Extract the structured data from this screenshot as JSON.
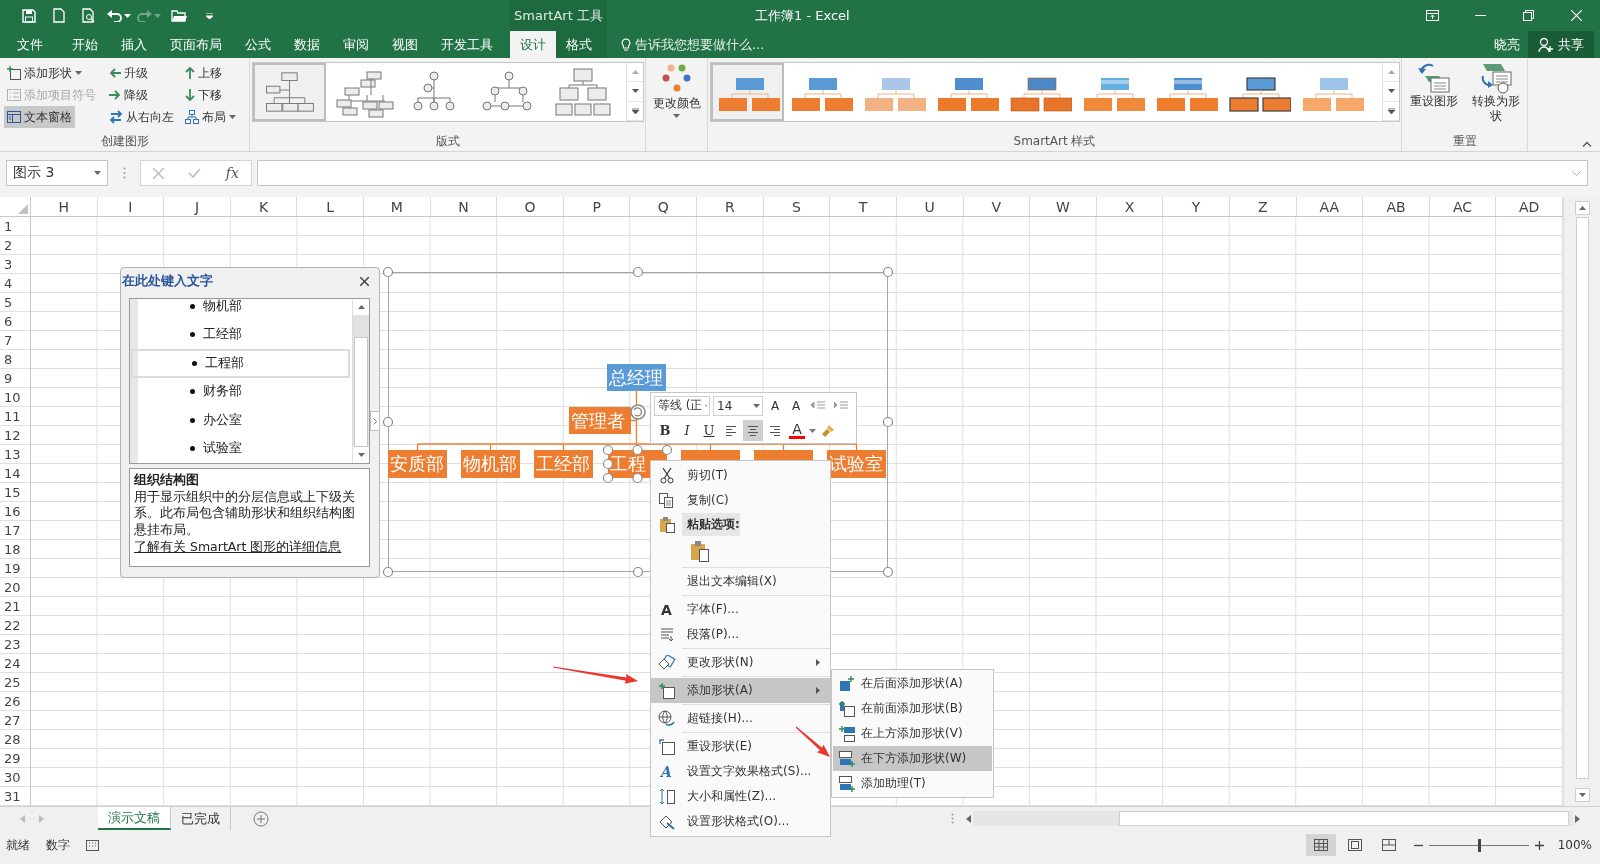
{
  "window": {
    "title": "工作簿1 - Excel",
    "context_group": "SmartArt 工具"
  },
  "ribbon_tabs": [
    {
      "label": "文件",
      "selected": false,
      "contextual": false
    },
    {
      "label": "开始",
      "selected": false,
      "contextual": false
    },
    {
      "label": "插入",
      "selected": false,
      "contextual": false
    },
    {
      "label": "页面布局",
      "selected": false,
      "contextual": false
    },
    {
      "label": "公式",
      "selected": false,
      "contextual": false
    },
    {
      "label": "数据",
      "selected": false,
      "contextual": false
    },
    {
      "label": "审阅",
      "selected": false,
      "contextual": false
    },
    {
      "label": "视图",
      "selected": false,
      "contextual": false
    },
    {
      "label": "开发工具",
      "selected": false,
      "contextual": false
    },
    {
      "label": "设计",
      "selected": true,
      "contextual": true
    },
    {
      "label": "格式",
      "selected": false,
      "contextual": true
    }
  ],
  "tell_me": {
    "placeholder": "告诉我您想要做什么..."
  },
  "account": {
    "user": "晓亮",
    "share": "共享"
  },
  "ribbon": {
    "create_group": {
      "label": "创建图形",
      "buttons": [
        {
          "label": "添加形状",
          "dropdown": true,
          "disabled": false,
          "selected": false
        },
        {
          "label": "添加项目符号",
          "dropdown": false,
          "disabled": true,
          "selected": false
        },
        {
          "label": "文本窗格",
          "dropdown": false,
          "disabled": false,
          "selected": true
        },
        {
          "label": "升级",
          "dropdown": false,
          "disabled": false,
          "selected": false
        },
        {
          "label": "降级",
          "dropdown": false,
          "disabled": false,
          "selected": false
        },
        {
          "label": "从右向左",
          "dropdown": false,
          "disabled": false,
          "selected": false
        },
        {
          "label": "上移",
          "dropdown": false,
          "disabled": false,
          "selected": false
        },
        {
          "label": "下移",
          "dropdown": false,
          "disabled": false,
          "selected": false
        },
        {
          "label": "布局",
          "dropdown": true,
          "disabled": false,
          "selected": false
        }
      ]
    },
    "layout_group": {
      "label": "版式",
      "layouts": [
        {
          "selected": true
        },
        {
          "selected": false
        },
        {
          "selected": false
        },
        {
          "selected": false
        },
        {
          "selected": false
        }
      ]
    },
    "color_button": {
      "label": "更改颜色"
    },
    "style_group": {
      "label": "SmartArt 样式",
      "styles": [
        {
          "selected": true
        },
        {
          "selected": false
        },
        {
          "selected": false
        },
        {
          "selected": false
        },
        {
          "selected": false
        },
        {
          "selected": false
        },
        {
          "selected": false
        },
        {
          "selected": false
        },
        {
          "selected": false
        }
      ]
    },
    "reset_group": {
      "label": "重置",
      "buttons": [
        {
          "label": "重设图形"
        },
        {
          "label": "转换为形状"
        }
      ]
    }
  },
  "formula_bar": {
    "name_box": "图示 3",
    "function_label": "fx"
  },
  "sheet": {
    "columns": [
      "H",
      "I",
      "J",
      "K",
      "L",
      "M",
      "N",
      "O",
      "P",
      "Q",
      "R",
      "S",
      "T",
      "U",
      "V",
      "W",
      "X",
      "Y",
      "Z",
      "AA",
      "AB",
      "AC",
      "AD"
    ],
    "rows": [
      "1",
      "2",
      "3",
      "4",
      "5",
      "6",
      "7",
      "8",
      "9",
      "10",
      "11",
      "12",
      "13",
      "14",
      "15",
      "16",
      "17",
      "18",
      "19",
      "20",
      "21",
      "22",
      "23",
      "24",
      "25",
      "26",
      "27",
      "28",
      "29",
      "30",
      "31"
    ]
  },
  "text_pane": {
    "title": "在此处键入文字",
    "items": [
      {
        "text": "物机部",
        "selected": false
      },
      {
        "text": "工经部",
        "selected": false
      },
      {
        "text": "工程部",
        "selected": true
      },
      {
        "text": "财务部",
        "selected": false
      },
      {
        "text": "办公室",
        "selected": false
      },
      {
        "text": "试验室",
        "selected": false
      }
    ],
    "description_title": "组织结构图",
    "description": "用于显示组织中的分层信息或上下级关系。此布局包含辅助形状和组织结构图悬挂布局。",
    "link": "了解有关 SmartArt 图形的详细信息"
  },
  "smartart": {
    "root": {
      "text": "总经理",
      "color": "#5b9bd5",
      "assistant": {
        "text": "管理者",
        "color": "#ed7d31"
      },
      "children": [
        {
          "text": "安质部",
          "color": "#ed7d31",
          "selected": false
        },
        {
          "text": "物机部",
          "color": "#ed7d31",
          "selected": false
        },
        {
          "text": "工经部",
          "color": "#ed7d31",
          "selected": false
        },
        {
          "text": "工程",
          "color": "#ed7d31",
          "selected": true
        },
        {
          "color": "#ed7d31",
          "selected": false
        },
        {
          "color": "#ed7d31",
          "selected": false
        },
        {
          "text": "试验室",
          "color": "#ed7d31",
          "selected": false
        }
      ]
    }
  },
  "mini_toolbar": {
    "font": "等线 (正",
    "size": "14",
    "grow_font": "A",
    "shrink_font": "A",
    "styles": [
      "B",
      "I",
      "U"
    ],
    "alignments": [
      {
        "selected": false
      },
      {
        "selected": true
      },
      {
        "selected": false
      }
    ],
    "font_color": {
      "label": "A",
      "color": "#ff0000"
    }
  },
  "context_menu": {
    "sections": [
      [
        {
          "kind": "item",
          "label": "剪切(T)",
          "submenu": false,
          "selected": false
        },
        {
          "kind": "item",
          "label": "复制(C)",
          "submenu": false,
          "selected": false
        },
        {
          "kind": "header",
          "label": "粘贴选项:"
        },
        {
          "kind": "paste",
          "selected": false
        }
      ],
      [
        {
          "kind": "item",
          "label": "退出文本编辑(X)",
          "submenu": false,
          "selected": false
        }
      ],
      [
        {
          "kind": "item",
          "label": "字体(F)...",
          "glyph": "A",
          "submenu": false,
          "selected": false
        },
        {
          "kind": "item",
          "label": "段落(P)...",
          "submenu": false,
          "selected": false
        }
      ],
      [
        {
          "kind": "item",
          "label": "更改形状(N)",
          "submenu": true,
          "selected": false
        }
      ],
      [
        {
          "kind": "item",
          "label": "添加形状(A)",
          "submenu": true,
          "selected": true
        }
      ],
      [
        {
          "kind": "item",
          "label": "超链接(H)...",
          "submenu": false,
          "selected": false
        }
      ],
      [
        {
          "kind": "item",
          "label": "重设形状(E)",
          "submenu": false,
          "selected": false
        },
        {
          "kind": "item",
          "label": "设置文字效果格式(S)...",
          "glyph": "A",
          "submenu": false,
          "selected": false
        },
        {
          "kind": "item",
          "label": "大小和属性(Z)...",
          "submenu": false,
          "selected": false
        },
        {
          "kind": "item",
          "label": "设置形状格式(O)...",
          "submenu": false,
          "selected": false
        }
      ]
    ]
  },
  "submenu": {
    "items": [
      {
        "label": "在后面添加形状(A)",
        "selected": false
      },
      {
        "label": "在前面添加形状(B)",
        "selected": false
      },
      {
        "label": "在上方添加形状(V)",
        "selected": false
      },
      {
        "label": "在下方添加形状(W)",
        "selected": true
      },
      {
        "label": "添加助理(T)",
        "selected": false
      }
    ]
  },
  "sheet_tabs": [
    {
      "label": "演示文稿",
      "selected": true
    },
    {
      "label": "已完成",
      "selected": false
    }
  ],
  "status_bar": {
    "mode": "就绪",
    "num_lock": "数字",
    "views": [
      {
        "selected": true
      },
      {
        "selected": false
      },
      {
        "selected": false
      }
    ],
    "zoom_slider": {
      "level": 0.5
    },
    "zoom": "100%"
  }
}
